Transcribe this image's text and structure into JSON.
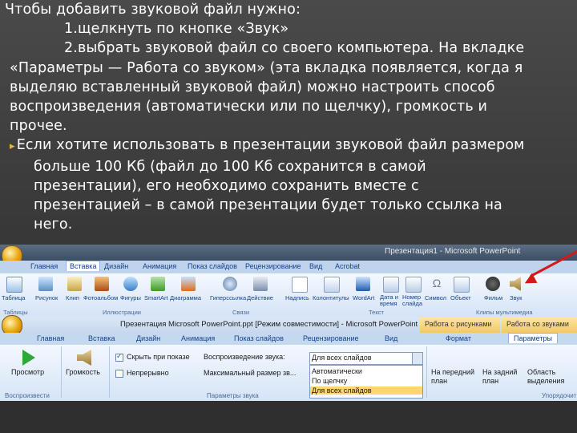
{
  "text": {
    "intro": "Чтобы добавить звуковой файл нужно:",
    "step1": "1.щелкнуть по кнопке «Звук»",
    "step2_lines": [
      "2.выбрать звуковой файл со своего компьютера. На вкладке",
      "«Параметры — Работа со звуком» (эта вкладка появляется, когда я",
      "выделяю вставленный звуковой файл) можно настроить способ",
      "воспроизведения (автоматически или по щелчку), громкость и",
      "прочее."
    ],
    "para2_lines": [
      "Если хотите использовать в презентации звуковой файл размером",
      "больше 100 Кб (файл до 100 Кб сохранится в самой",
      "презентации), его необходимо сохранить вместе с",
      "презентацией – в самой презентации будет только ссылка на",
      "него."
    ]
  },
  "shot1": {
    "title": "Презентация1 - Microsoft PowerPoint",
    "tabs": [
      "Главная",
      "Вставка",
      "Дизайн",
      "Анимация",
      "Показ слайдов",
      "Рецензирование",
      "Вид",
      "Acrobat"
    ],
    "active_tab": "Вставка",
    "items": [
      "Таблица",
      "Рисунок",
      "Клип",
      "Фотоальбом",
      "Фигуры",
      "SmartArt",
      "Диаграмма",
      "Гиперссылка",
      "Действие",
      "Надпись",
      "Колонтитулы",
      "WordArt",
      "Дата и время",
      "Номер слайда",
      "Символ",
      "Объект",
      "Фильм",
      "Звук"
    ],
    "groups": [
      "Таблицы",
      "Иллюстрации",
      "Связи",
      "Текст",
      "Клипы мультимедиа"
    ]
  },
  "shot2": {
    "title": "Презентация Microsoft PowerPoint.ppt [Режим совместимости] - Microsoft PowerPoint",
    "context_tabs": [
      "Работа с рисунками",
      "Работа со звуками"
    ],
    "tabs": [
      "Главная",
      "Вставка",
      "Дизайн",
      "Анимация",
      "Показ слайдов",
      "Рецензирование",
      "Вид",
      "Формат",
      "Параметры"
    ],
    "active_tab": "Параметры",
    "preview_label": "Просмотр",
    "volume_label": "Громкость",
    "checkbox_hide": "Скрыть при показе",
    "checkbox_loop": "Непрерывно",
    "play_sound_label": "Воспроизведение звука:",
    "play_sound_value": "Для всех слайдов",
    "max_size_label": "Максимальный размер зв...",
    "menu_options": [
      "Автоматически",
      "По щелчку",
      "Для всех слайдов"
    ],
    "front_label": "На передний план",
    "back_label": "На задний план",
    "selection_label": "Область выделения",
    "groups": [
      "Воспроизвести",
      "Параметры звука",
      "Упорядочить"
    ]
  },
  "colors": {
    "bullet": "#e9b33a",
    "arrow": "#d21a1a",
    "ribbon_blue": "#dfe9f5"
  }
}
